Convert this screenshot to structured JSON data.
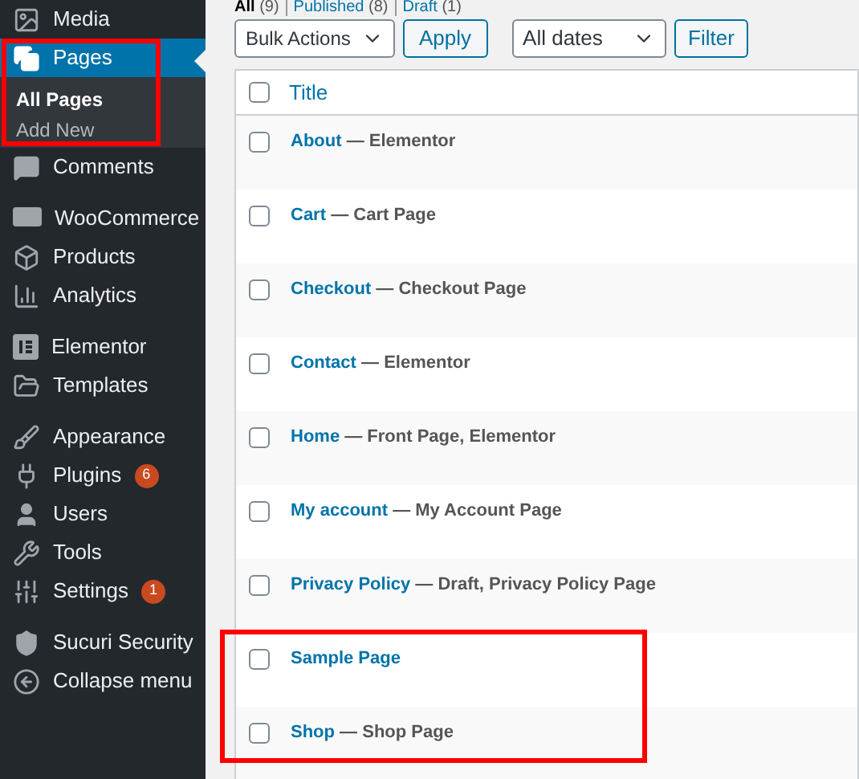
{
  "sidebar": {
    "groups": [
      {
        "items": [
          {
            "label": "Media",
            "selected": false
          },
          {
            "label": "Pages",
            "selected": true,
            "children": [
              {
                "label": "All Pages",
                "selected": true
              },
              {
                "label": "Add New",
                "selected": false
              }
            ]
          },
          {
            "label": "Comments",
            "selected": false
          }
        ]
      },
      {
        "items": [
          {
            "label": "WooCommerce",
            "selected": false
          },
          {
            "label": "Products",
            "selected": false
          },
          {
            "label": "Analytics",
            "selected": false
          }
        ]
      },
      {
        "items": [
          {
            "label": "Elementor",
            "selected": false
          },
          {
            "label": "Templates",
            "selected": false
          }
        ]
      },
      {
        "items": [
          {
            "label": "Appearance",
            "selected": false
          },
          {
            "label": "Plugins",
            "selected": false,
            "badge": "6"
          },
          {
            "label": "Users",
            "selected": false
          },
          {
            "label": "Tools",
            "selected": false
          },
          {
            "label": "Settings",
            "selected": false,
            "badge": "1"
          }
        ]
      },
      {
        "items": [
          {
            "label": "Sucuri Security",
            "selected": false
          },
          {
            "label": "Collapse menu",
            "selected": false
          }
        ]
      }
    ]
  },
  "filters": [
    {
      "label": "All",
      "count": "(9)",
      "selected": true
    },
    {
      "label": "Published",
      "count": "(8)",
      "selected": false
    },
    {
      "label": "Draft",
      "count": "(1)",
      "selected": false
    }
  ],
  "toolbar": {
    "bulk_actions": "Bulk Actions",
    "apply": "Apply",
    "dates": "All dates",
    "filter": "Filter"
  },
  "table": {
    "columns": [
      "Title"
    ],
    "all_checked": false,
    "rows": [
      {
        "title": "About",
        "state": " — Elementor",
        "checked": false
      },
      {
        "title": "Cart",
        "state": " — Cart Page",
        "checked": false
      },
      {
        "title": "Checkout",
        "state": " — Checkout Page",
        "checked": false
      },
      {
        "title": "Contact",
        "state": " — Elementor",
        "checked": false
      },
      {
        "title": "Home",
        "state": " — Front Page, Elementor",
        "checked": false
      },
      {
        "title": "My account",
        "state": " — My Account Page",
        "checked": false
      },
      {
        "title": "Privacy Policy",
        "state": " — Draft, Privacy Policy Page",
        "checked": false
      },
      {
        "title": "Sample Page",
        "checked": false
      },
      {
        "title": "Shop",
        "state": " — Shop Page",
        "checked": false
      }
    ]
  }
}
